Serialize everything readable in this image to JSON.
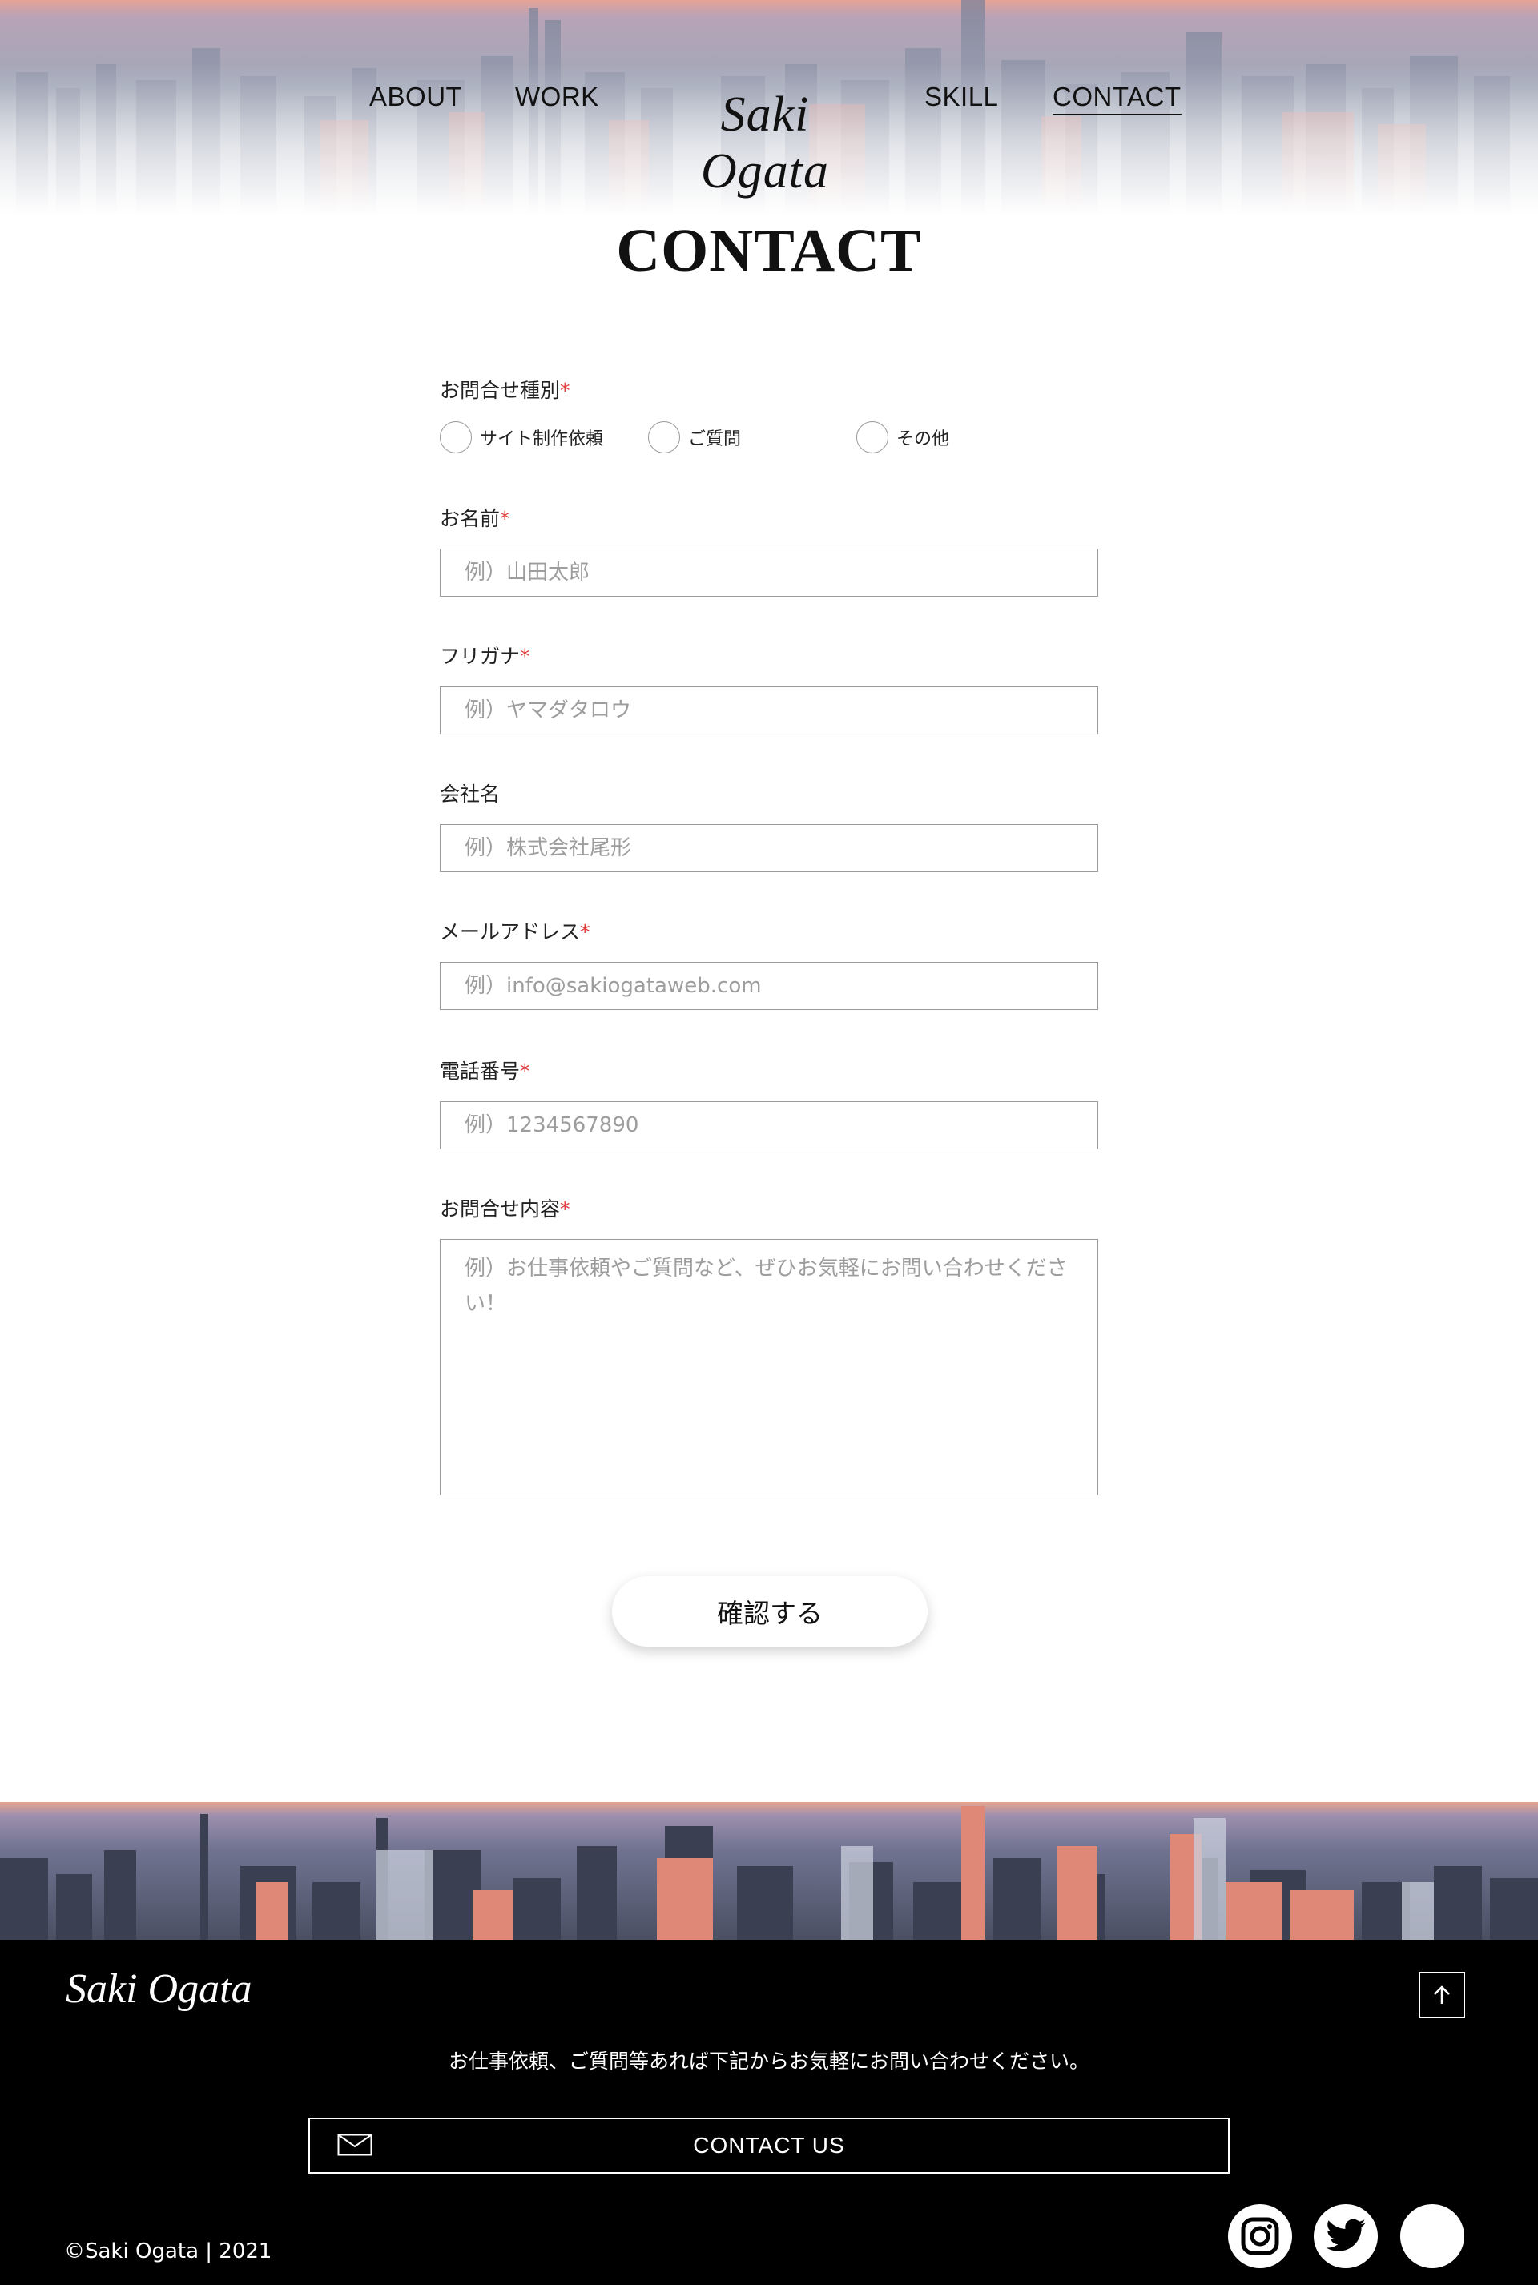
{
  "header": {
    "logo": "Saki Ogata",
    "nav": [
      {
        "label": "ABOUT"
      },
      {
        "label": "WORK"
      },
      {
        "label": "SKILL"
      },
      {
        "label": "CONTACT",
        "active": true
      }
    ]
  },
  "page_title": "CONTACT",
  "form": {
    "inquiry_type": {
      "label": "お問合せ種別",
      "required_mark": "*",
      "options": [
        "サイト制作依頼",
        "ご質問",
        "その他"
      ]
    },
    "name": {
      "label": "お名前",
      "required_mark": "*",
      "placeholder": "例）山田太郎",
      "value": ""
    },
    "furigana": {
      "label": "フリガナ",
      "required_mark": "*",
      "placeholder": "例）ヤマダタロウ",
      "value": ""
    },
    "company": {
      "label": "会社名",
      "placeholder": "例）株式会社尾形",
      "value": ""
    },
    "email": {
      "label": "メールアドレス",
      "required_mark": "*",
      "placeholder": "例）info@sakiogataweb.com",
      "value": ""
    },
    "phone": {
      "label": "電話番号",
      "required_mark": "*",
      "placeholder": "例）1234567890",
      "value": ""
    },
    "message": {
      "label": "お問合せ内容",
      "required_mark": "*",
      "placeholder": "例）お仕事依頼やご質問など、ぜひお気軽にお問い合わせください！",
      "value": ""
    },
    "submit_label": "確認する"
  },
  "footer": {
    "logo": "Saki Ogata",
    "message": "お仕事依頼、ご質問等あれば下記からお気軽にお問い合わせください。",
    "contact_button": "CONTACT  US",
    "copyright": "©Saki Ogata | 2021",
    "icons": [
      "arrow-up-icon",
      "mail-icon",
      "instagram-icon",
      "twitter-icon",
      "social-icon"
    ]
  },
  "colors": {
    "required": "#e03a3a",
    "footer_bg": "#000000",
    "border": "#9a9a9a",
    "placeholder": "#9d9d9d"
  }
}
